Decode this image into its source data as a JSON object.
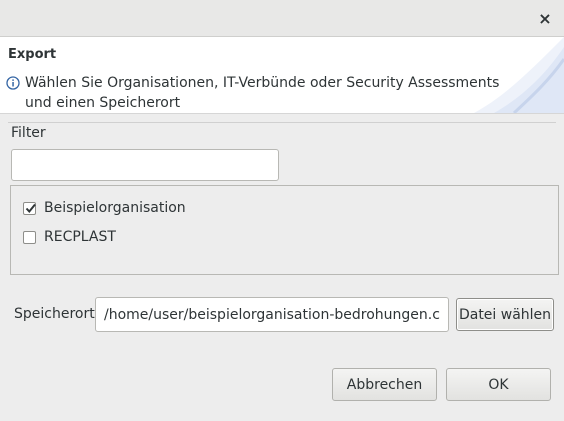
{
  "dialog": {
    "close_glyph": "×"
  },
  "banner": {
    "title": "Export",
    "message_line1": "Wählen Sie Organisationen, IT-Verbünde oder Security Assessments",
    "message_line2": "und einen Speicherort"
  },
  "filter": {
    "label": "Filter",
    "value": "",
    "placeholder": ""
  },
  "items": [
    {
      "label": "Beispielorganisation",
      "checked": true
    },
    {
      "label": "RECPLAST",
      "checked": false
    }
  ],
  "location": {
    "label": "Speicherort",
    "value": "/home/user/beispielorganisation-bedrohungen.csv",
    "choose_label": "Datei wählen"
  },
  "buttons": {
    "cancel": "Abbrechen",
    "ok": "OK"
  },
  "colors": {
    "banner_deco": "#c7d4ec",
    "info_icon": "#3465a4"
  }
}
